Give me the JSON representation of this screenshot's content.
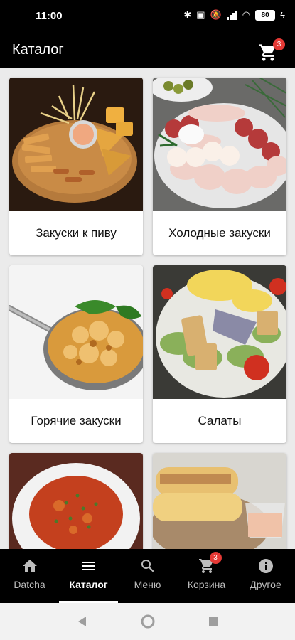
{
  "status_bar": {
    "time": "11:00",
    "battery": "80"
  },
  "app_bar": {
    "title": "Каталог",
    "cart_count": "3"
  },
  "categories": [
    {
      "label": "Закуски к пиву",
      "image": "beer-snacks-platter"
    },
    {
      "label": "Холодные закуски",
      "image": "cold-cuts-platter"
    },
    {
      "label": "Горячие закуски",
      "image": "baked-cheese-pan"
    },
    {
      "label": "Салаты",
      "image": "caesar-salad"
    },
    {
      "label": "",
      "image": "soup-bowl"
    },
    {
      "label": "",
      "image": "wraps-with-sauce"
    }
  ],
  "bottom_nav": {
    "items": [
      {
        "label": "Datcha",
        "icon": "home-icon"
      },
      {
        "label": "Каталог",
        "icon": "menu-lines-icon"
      },
      {
        "label": "Меню",
        "icon": "search-icon"
      },
      {
        "label": "Корзина",
        "icon": "cart-icon"
      },
      {
        "label": "Другое",
        "icon": "info-icon"
      }
    ],
    "active_index": 1,
    "cart_badge": "3"
  },
  "colors": {
    "bar_background": "#000000",
    "badge": "#e53935",
    "page_background": "#ebebeb"
  }
}
